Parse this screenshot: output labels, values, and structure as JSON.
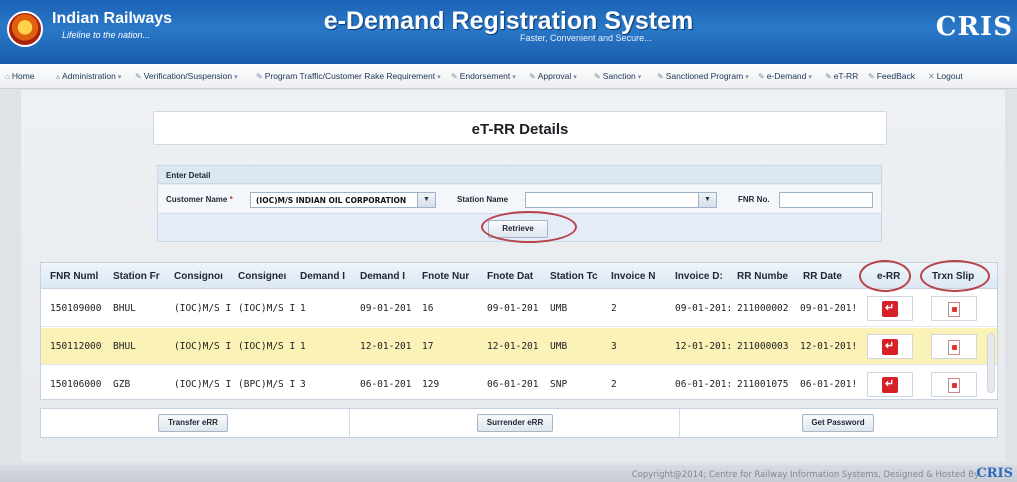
{
  "header": {
    "brand": "Indian Railways",
    "tagline": "Lifeline to the nation...",
    "title": "e-Demand Registration System",
    "subtitle": "Faster, Convenient and Secure...",
    "right_logo": "CRIS"
  },
  "menu": [
    {
      "label": "Home",
      "icon": "home-icon",
      "dropdown": false
    },
    {
      "label": "Administration",
      "icon": "triangle-icon",
      "dropdown": true
    },
    {
      "label": "Verification/Suspension",
      "icon": "pencil-icon",
      "dropdown": true
    },
    {
      "label": "Program Traffic/Customer Rake Requirement",
      "icon": "pencil-icon",
      "dropdown": true
    },
    {
      "label": "Endorsement",
      "icon": "pencil-icon",
      "dropdown": true
    },
    {
      "label": "Approval",
      "icon": "pencil-icon",
      "dropdown": true
    },
    {
      "label": "Sanction",
      "icon": "pencil-icon",
      "dropdown": true
    },
    {
      "label": "Sanctioned Program",
      "icon": "pencil-icon",
      "dropdown": true
    },
    {
      "label": "e-Demand",
      "icon": "pencil-icon",
      "dropdown": true
    },
    {
      "label": "eT-RR",
      "icon": "pencil-icon",
      "dropdown": false
    },
    {
      "label": "FeedBack",
      "icon": "pencil-icon",
      "dropdown": false
    },
    {
      "label": "Logout",
      "icon": "close-icon",
      "dropdown": false
    }
  ],
  "page_title": "eT-RR Details",
  "form": {
    "section_label": "Enter Detail",
    "customer_label": "Customer Name",
    "customer_required": "*",
    "customer_value": "(IOC)M/S INDIAN OIL CORPORATION",
    "station_label": "Station Name",
    "station_value": "",
    "fnr_label": "FNR No.",
    "fnr_value": "",
    "retrieve_label": "Retrieve"
  },
  "table": {
    "headers": [
      "FNR Numl",
      "Station Fr",
      "Consignoı",
      "Consigneı",
      "Demand I",
      "Demand I",
      "Fnote Nur",
      "Fnote Dat",
      "Station Tc",
      "Invoice N",
      "Invoice D:",
      "RR Numbe",
      "RR Date",
      "e-RR",
      "Trxn Slip"
    ],
    "rows": [
      {
        "fnr": "150109000",
        "station_from": "BHUL",
        "consignor": "(IOC)M/S I",
        "consignee": "(IOC)M/S I",
        "demand_no": "1",
        "demand_date": "09-01-201",
        "fnote_no": "16",
        "fnote_date": "09-01-201",
        "station_to": "UMB",
        "invoice_no": "2",
        "invoice_date": "09-01-201:",
        "rr_no": "211000002",
        "rr_date": "09-01-201!",
        "selected": false
      },
      {
        "fnr": "150112000",
        "station_from": "BHUL",
        "consignor": "(IOC)M/S I",
        "consignee": "(IOC)M/S I",
        "demand_no": "1",
        "demand_date": "12-01-201",
        "fnote_no": "17",
        "fnote_date": "12-01-201",
        "station_to": "UMB",
        "invoice_no": "3",
        "invoice_date": "12-01-201:",
        "rr_no": "211000003",
        "rr_date": "12-01-201!",
        "selected": true
      },
      {
        "fnr": "150106000",
        "station_from": "GZB",
        "consignor": "(IOC)M/S I",
        "consignee": "(BPC)M/S I",
        "demand_no": "3",
        "demand_date": "06-01-201",
        "fnote_no": "129",
        "fnote_date": "06-01-201",
        "station_to": "SNP",
        "invoice_no": "2",
        "invoice_date": "06-01-201:",
        "rr_no": "211001075",
        "rr_date": "06-01-201!",
        "selected": false
      }
    ]
  },
  "actions": {
    "transfer": "Transfer eRR",
    "surrender": "Surrender eRR",
    "password": "Get Password"
  },
  "footer": {
    "copyright": "Copyright@2014; Centre for Railway Information Systems, Designed & Hosted By",
    "brand": "CRIS"
  },
  "colors": {
    "header_blue": "#1b62b5",
    "selected_row": "#fbf2b8",
    "highlight_ring": "#b8434a",
    "pdf_red": "#d61f26"
  }
}
